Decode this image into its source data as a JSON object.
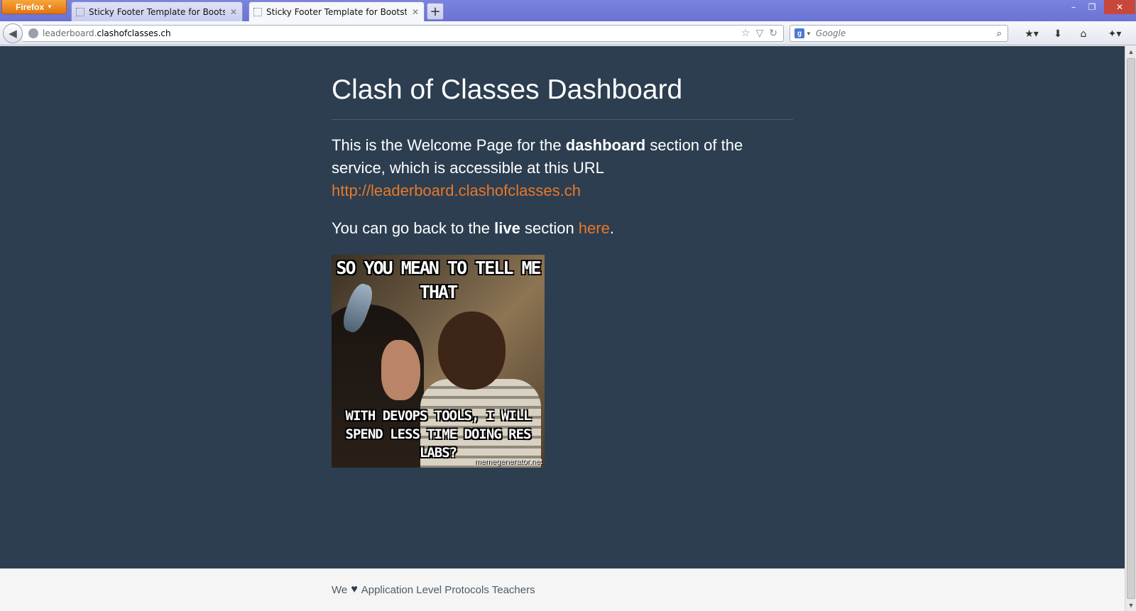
{
  "browser": {
    "menu_button": "Firefox",
    "tabs": [
      {
        "label": "Sticky Footer Template for Bootstrap",
        "active": false
      },
      {
        "label": "Sticky Footer Template for Bootstrap",
        "active": true
      }
    ],
    "new_tab": "+",
    "window_controls": {
      "minimize": "–",
      "restore": "❐",
      "close": "✕"
    },
    "url": {
      "subdomain": "leaderboard.",
      "domain": "clashofclasses.ch"
    },
    "search": {
      "engine": "g",
      "placeholder": "Google"
    }
  },
  "page": {
    "title": "Clash of Classes Dashboard",
    "p1_a": "This is the Welcome Page for the ",
    "p1_b": "dashboard",
    "p1_c": " section of the service, which is accessible at this URL ",
    "p1_link": "http://leaderboard.clashofclasses.ch",
    "p2_a": "You can go back to the ",
    "p2_b": "live",
    "p2_c": " section ",
    "p2_link": "here",
    "p2_d": ".",
    "meme": {
      "top_text": "SO YOU MEAN TO TELL ME THAT",
      "bottom_text": "WITH DEVOPS TOOLS, I WILL SPEND LESS TIME DOING RES LABS?",
      "credit": "memegenerator.net"
    }
  },
  "footer": {
    "text_before": "We",
    "heart": "♥",
    "text_after": "Application Level Protocols Teachers"
  },
  "colors": {
    "page_bg": "#2c3e50",
    "link": "#e8782a",
    "footer_bg": "#f5f5f5"
  }
}
